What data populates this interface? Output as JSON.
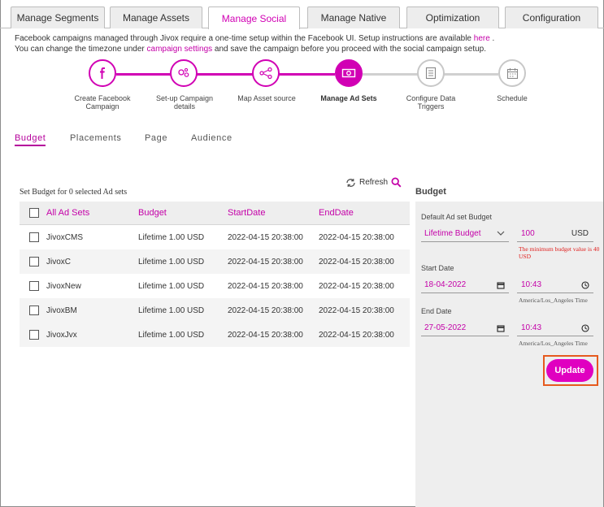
{
  "tabs": [
    {
      "label": "Manage Segments"
    },
    {
      "label": "Manage Assets"
    },
    {
      "label": "Manage Social"
    },
    {
      "label": "Manage Native"
    },
    {
      "label": "Optimization"
    },
    {
      "label": "Configuration"
    }
  ],
  "active_tab": "Manage Social",
  "info": {
    "line1_text": "Facebook campaigns managed through Jivox require a one-time setup within the Facebook UI. Setup instructions are available ",
    "line1_link": "here",
    "line1_end": " .",
    "line2_text": "You can change the timezone under ",
    "line2_link": "campaign settings",
    "line2_end": " and save the campaign before you proceed with the social campaign setup."
  },
  "steps": [
    {
      "label": "Create Facebook Campaign",
      "icon": "facebook-icon",
      "state": "done"
    },
    {
      "label": "Set-up Campaign details",
      "icon": "settings-gears-icon",
      "state": "done"
    },
    {
      "label": "Map Asset source",
      "icon": "share-nodes-icon",
      "state": "done"
    },
    {
      "label": "Manage Ad Sets",
      "icon": "money-icon",
      "state": "current"
    },
    {
      "label": "Configure Data Triggers",
      "icon": "list-icon",
      "state": "todo"
    },
    {
      "label": "Schedule",
      "icon": "calendar-icon",
      "state": "todo"
    }
  ],
  "subtabs": [
    {
      "label": "Budget"
    },
    {
      "label": "Placements"
    },
    {
      "label": "Page"
    },
    {
      "label": "Audience"
    }
  ],
  "set_budget_label": "Set Budget for 0 selected Ad sets",
  "refresh_label": "Refresh",
  "table": {
    "headers": [
      "All Ad Sets",
      "Budget",
      "StartDate",
      "EndDate"
    ],
    "rows": [
      [
        "JivoxCMS",
        "Lifetime 1.00 USD",
        "2022-04-15 20:38:00",
        "2022-04-15 20:38:00"
      ],
      [
        "JivoxC",
        "Lifetime 1.00 USD",
        "2022-04-15 20:38:00",
        "2022-04-15 20:38:00"
      ],
      [
        "JivoxNew",
        "Lifetime 1.00 USD",
        "2022-04-15 20:38:00",
        "2022-04-15 20:38:00"
      ],
      [
        "JivoxBM",
        "Lifetime 1.00 USD",
        "2022-04-15 20:38:00",
        "2022-04-15 20:38:00"
      ],
      [
        "JivoxJvx",
        "Lifetime 1.00 USD",
        "2022-04-15 20:38:00",
        "2022-04-15 20:38:00"
      ]
    ]
  },
  "budget_panel": {
    "title": "Budget",
    "default_label": "Default Ad set Budget",
    "budget_type": "Lifetime Budget",
    "amount": "100",
    "currency": "USD",
    "error": "The minimum budget value is 40 USD",
    "start_label": "Start Date",
    "start_date": "18-04-2022",
    "start_time": "10:43",
    "end_label": "End Date",
    "end_date": "27-05-2022",
    "end_time": "10:43",
    "timezone": "America/Los_Angeles Time",
    "update_label": "Update"
  },
  "colors": {
    "accent": "#d100b4",
    "highlight": "#e65a1e",
    "inactive": "#c8c8c8"
  }
}
